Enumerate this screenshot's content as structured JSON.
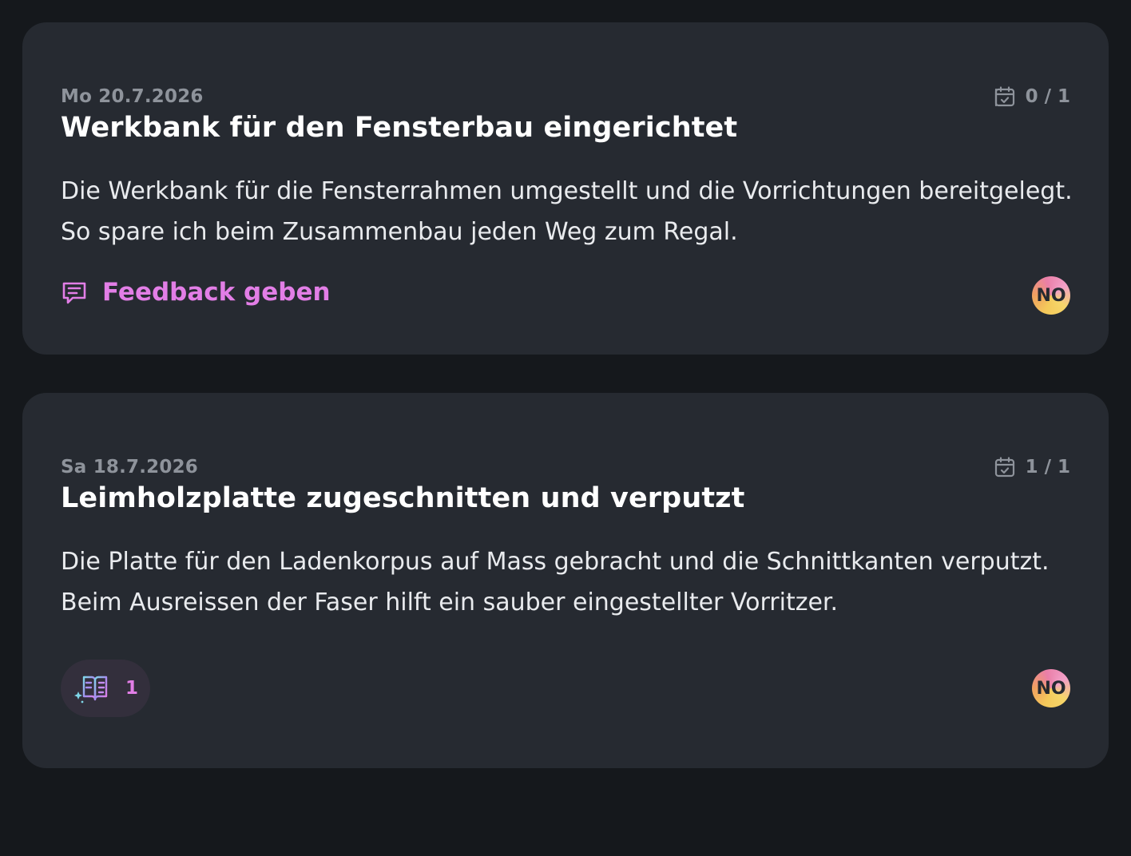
{
  "entries": [
    {
      "date": "Mo 20.7.2026",
      "tasks": "0 / 1",
      "title": "Werkbank für den Fensterbau eingerichtet",
      "body_lines": [
        "Die Werkbank für die Fensterrahmen umgestellt und die Vorrichtungen bereitgelegt.",
        "So spare ich beim Zusammenbau jeden Weg zum Regal."
      ],
      "feedback_label": "Feedback geben",
      "avatar_initials": "NO"
    },
    {
      "date": "Sa 18.7.2026",
      "tasks": "1 / 1",
      "title": "Leimholzplatte zugeschnitten und verputzt",
      "body_lines": [
        "Die Platte für den Ladenkorpus auf Mass gebracht und die Schnittkanten verputzt.",
        "Beim Ausreissen der Faser hilft ein sauber eingestellter Vorritzer."
      ],
      "ai_feedback_count": "1",
      "avatar_initials": "NO"
    }
  ],
  "icons": {
    "tasks": "calendar-check-icon",
    "feedback": "comment-icon",
    "ai_feedback": "sparkle-book-icon"
  },
  "colors": {
    "background": "#15181c",
    "card": "#262a31",
    "accent": "#e27ee6",
    "muted": "#8e939b"
  }
}
